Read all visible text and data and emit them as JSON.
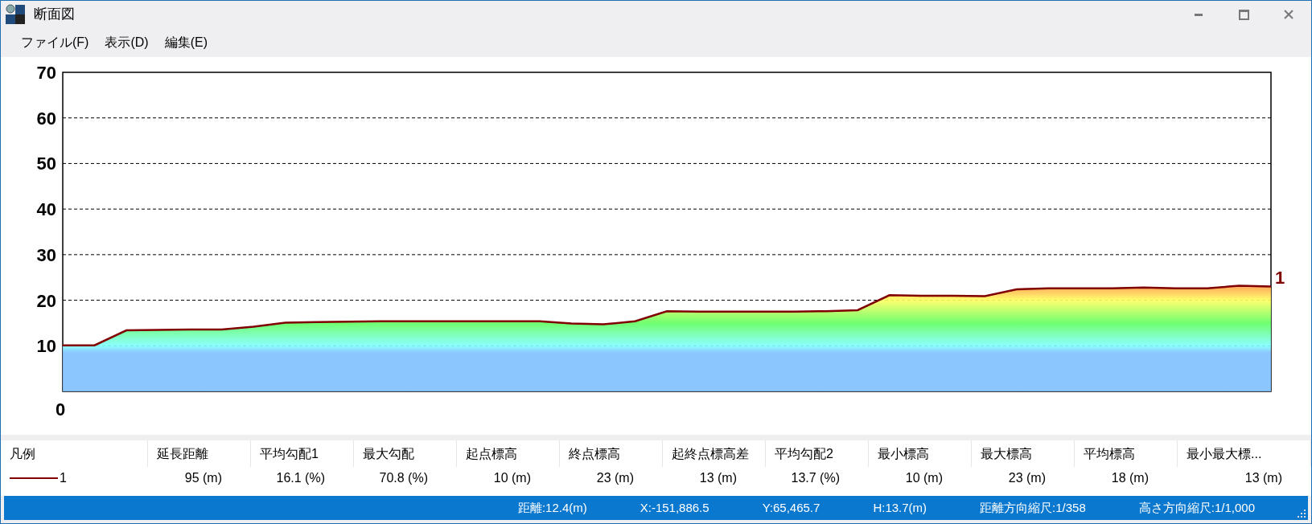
{
  "window": {
    "title": "断面図"
  },
  "menu": [
    "ファイル(F)",
    "表示(D)",
    "編集(E)"
  ],
  "chart": {
    "origin_label": "0",
    "chart_data": {
      "type": "area",
      "categories": [
        null,
        null,
        null,
        null,
        null,
        null,
        null,
        null,
        null,
        null,
        null,
        null,
        null,
        null,
        null,
        null,
        null,
        null,
        null,
        null,
        null,
        null,
        null,
        null,
        null,
        null,
        null,
        null,
        null,
        null,
        null,
        null,
        null,
        null,
        null,
        null,
        null,
        null,
        null
      ],
      "series": [
        {
          "name": "1",
          "color": "#800000",
          "values": [
            10.1,
            10.1,
            13.4,
            13.5,
            13.6,
            13.6,
            14.2,
            15.1,
            15.2,
            15.3,
            15.4,
            15.4,
            15.4,
            15.4,
            15.4,
            15.4,
            14.9,
            14.7,
            15.4,
            17.6,
            17.5,
            17.5,
            17.5,
            17.5,
            17.6,
            17.8,
            21.1,
            21.0,
            21.0,
            20.9,
            22.4,
            22.6,
            22.6,
            22.6,
            22.8,
            22.6,
            22.6,
            23.2,
            23.0
          ]
        }
      ],
      "ylim": [
        0,
        70
      ],
      "yticks": [
        10,
        20,
        30,
        40,
        50,
        60,
        70
      ],
      "grid": true
    }
  },
  "table": {
    "columns": [
      "凡例",
      "延長距離",
      "平均勾配1",
      "最大勾配",
      "起点標高",
      "終点標高",
      "起終点標高差",
      "平均勾配2",
      "最小標高",
      "最大標高",
      "平均標高",
      "最小最大標..."
    ],
    "rows": [
      {
        "cells": [
          "1",
          "95 (m)",
          "16.1 (%)",
          "70.8 (%)",
          "10 (m)",
          "23 (m)",
          "13 (m)",
          "13.7 (%)",
          "10 (m)",
          "23 (m)",
          "18 (m)",
          "13 (m)"
        ]
      }
    ]
  },
  "status_bar": [
    "距離:12.4(m)",
    "X:-151,886.5",
    "Y:65,465.7",
    "H:13.7(m)",
    "距離方向縮尺:1/358",
    "高さ方向縮尺:1/1,000"
  ]
}
